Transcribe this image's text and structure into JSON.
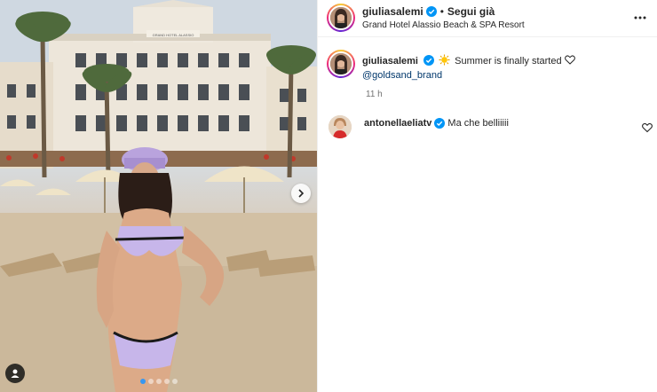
{
  "post": {
    "carousel_dots": 5,
    "active_dot": 0
  },
  "header": {
    "username": "giuliasalemi",
    "separator": "•",
    "follow_label": "Segui già",
    "location": "Grand Hotel Alassio Beach & SPA Resort"
  },
  "caption": {
    "username": "giuliasalemi",
    "text": "Summer is finally started",
    "mention": "@goldsand_brand",
    "time": "11 h"
  },
  "comments": [
    {
      "username": "antonellaeliatv",
      "text": "Ma che belliiiii"
    }
  ],
  "photo": {
    "hotel_sign": "GRAND HOTEL ALASSIO"
  },
  "icons": {
    "verified": "verified-badge-icon",
    "more": "more-options-icon",
    "next": "chevron-right-icon",
    "tag": "user-tag-icon",
    "like": "heart-icon",
    "emoji": "sun-emoji-icon"
  },
  "colors": {
    "verified": "#0095f6",
    "active_dot": "#3797f0",
    "mention": "#00376b"
  }
}
